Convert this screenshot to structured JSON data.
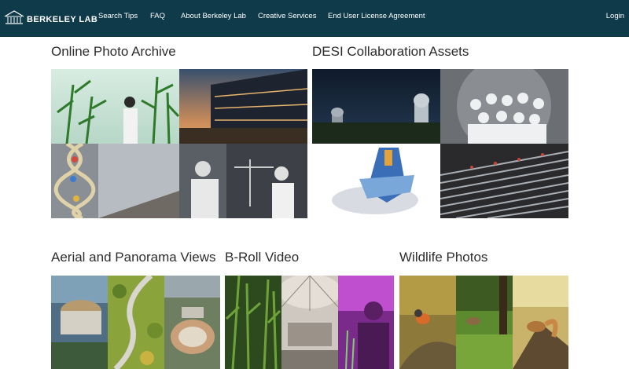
{
  "header": {
    "logo_text": "BERKELEY LAB",
    "nav": [
      "Search Tips",
      "FAQ",
      "About Berkeley Lab",
      "Creative Services",
      "End User License Agreement"
    ],
    "login": "Login"
  },
  "sections": [
    {
      "title": "Online Photo Archive"
    },
    {
      "title": "DESI Collaboration Assets"
    },
    {
      "title": "Aerial and Panorama Views"
    },
    {
      "title": "B-Roll Video"
    },
    {
      "title": "Wildlife Photos"
    }
  ],
  "colors": {
    "header_bg": "#0f3a4a",
    "header_text": "#ffffff",
    "title_text": "#2d2d2d"
  }
}
